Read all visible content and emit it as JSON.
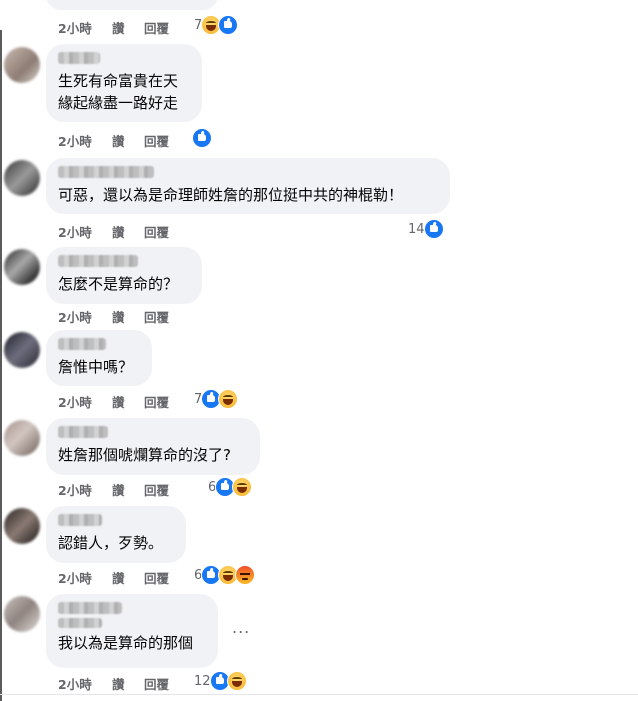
{
  "colors": {
    "bubble": "#f0f2f5",
    "like": "#1877f2",
    "meta_text": "#65676b"
  },
  "actions": {
    "like": "讚",
    "reply": "回覆"
  },
  "icons": {
    "like": "like-reaction-icon",
    "haha": "haha-reaction-icon",
    "angry": "angry-reaction-icon",
    "more": "more-options-icon"
  },
  "comments": [
    {
      "text": "",
      "time": "2小時",
      "reaction_count": "7",
      "reactions": [
        "haha",
        "like"
      ]
    },
    {
      "text": "生死有命富貴在天\n緣起緣盡一路好走",
      "time": "2小時",
      "reaction_count": "",
      "reactions": [
        "like"
      ]
    },
    {
      "text": "可惡，還以為是命理師姓詹的那位挺中共的神棍勒！",
      "time": "2小時",
      "reaction_count": "14",
      "reactions": [
        "like"
      ]
    },
    {
      "text": "怎麼不是算命的？",
      "time": "2小時",
      "reaction_count": "",
      "reactions": []
    },
    {
      "text": "詹惟中嗎？",
      "time": "2小時",
      "reaction_count": "7",
      "reactions": [
        "like",
        "haha"
      ]
    },
    {
      "text": "姓詹那個唬爛算命的沒了?",
      "time": "2小時",
      "reaction_count": "6",
      "reactions": [
        "like",
        "haha"
      ]
    },
    {
      "text": "認錯人，歹勢。",
      "time": "2小時",
      "reaction_count": "6",
      "reactions": [
        "like",
        "haha",
        "angry"
      ]
    },
    {
      "text": "我以為是算命的那個",
      "time": "2小時",
      "reaction_count": "12",
      "reactions": [
        "like",
        "haha"
      ],
      "more": "..."
    }
  ]
}
